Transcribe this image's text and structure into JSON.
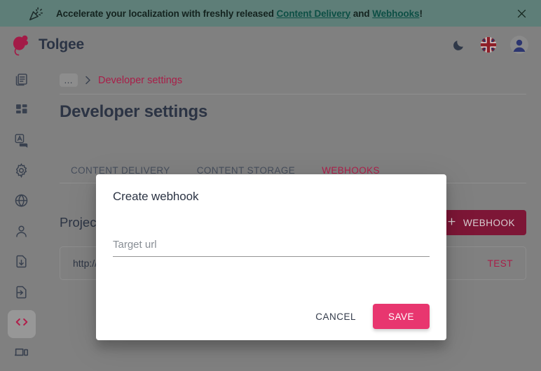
{
  "banner": {
    "icon": "party-popper-icon",
    "text_before": "Accelerate your localization with freshly released ",
    "link1": "Content Delivery",
    "text_middle": " and ",
    "link2": "Webhooks",
    "text_after": "!",
    "close_icon": "close-icon",
    "background_color": "#5e7e78",
    "link_color": "#0d4f45"
  },
  "appbar": {
    "brand_name": "Tolgee",
    "logo_icon": "tolgee-mouse-logo",
    "logo_color": "#a31b47",
    "dark_mode_icon": "moon-icon",
    "language_icon": "uk-flag-icon",
    "avatar_icon": "user-avatar"
  },
  "sidebar": {
    "items": [
      {
        "icon": "projects-icon",
        "label": "Projects",
        "active": false
      },
      {
        "icon": "dashboard-icon",
        "label": "Dashboard",
        "active": false
      },
      {
        "icon": "translations-icon",
        "label": "Translations",
        "active": false
      },
      {
        "icon": "settings-gear-icon",
        "label": "Settings",
        "active": false
      },
      {
        "icon": "globe-icon",
        "label": "Languages",
        "active": false
      },
      {
        "icon": "person-icon",
        "label": "Members",
        "active": false
      },
      {
        "icon": "export-icon",
        "label": "Export",
        "active": false
      },
      {
        "icon": "import-icon",
        "label": "Import",
        "active": false
      },
      {
        "icon": "code-brackets-icon",
        "label": "Developer settings",
        "active": true
      },
      {
        "icon": "integrate-devices-icon",
        "label": "Integrate",
        "active": false
      }
    ],
    "active_color": "#b01e4a"
  },
  "breadcrumb": {
    "ellipsis": "…",
    "separator": "›",
    "current": "Developer settings"
  },
  "page": {
    "title": "Developer settings",
    "tabs": [
      {
        "label": "CONTENT DELIVERY",
        "active": false
      },
      {
        "label": "CONTENT STORAGE",
        "active": false
      },
      {
        "label": "WEBHOOKS",
        "active": true
      }
    ],
    "section_title": "Project webhooks",
    "add_button": "WEBHOOK",
    "add_button_icon": "plus-icon",
    "webhook_row": {
      "url": "http://localhost",
      "test_label": "TEST"
    }
  },
  "modal": {
    "title": "Create webhook",
    "field": {
      "label": "Target url",
      "placeholder": "Target url",
      "value": ""
    },
    "cancel_label": "CANCEL",
    "save_label": "SAVE",
    "save_color": "#e8366f"
  }
}
